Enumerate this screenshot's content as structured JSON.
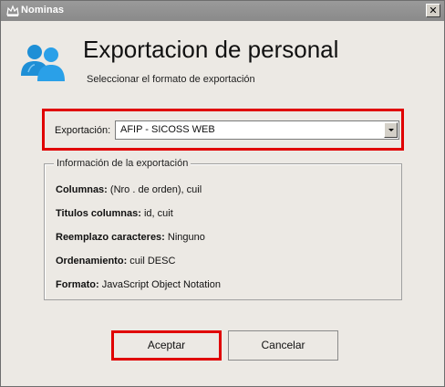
{
  "window": {
    "title": "Nominas",
    "close_glyph": "✕",
    "app_icon": "app-crown-icon"
  },
  "header": {
    "heading": "Exportacion de personal",
    "subtitle": "Seleccionar el formato de exportación",
    "icon": "people-icon",
    "icon_color": "#1e8fd6"
  },
  "export": {
    "label": "Exportación:",
    "selected": "AFIP - SICOSS WEB",
    "highlight_color": "#e00000"
  },
  "info": {
    "legend": "Información de la exportación",
    "rows": [
      {
        "key": "Columnas:",
        "value": "(Nro . de orden), cuil"
      },
      {
        "key": "Titulos columnas:",
        "value": "id, cuit"
      },
      {
        "key": "Reemplazo caracteres:",
        "value": "Ninguno"
      },
      {
        "key": "Ordenamiento:",
        "value": "cuil DESC"
      },
      {
        "key": "Formato:",
        "value": "JavaScript Object Notation"
      }
    ]
  },
  "buttons": {
    "ok": "Aceptar",
    "cancel": "Cancelar"
  }
}
